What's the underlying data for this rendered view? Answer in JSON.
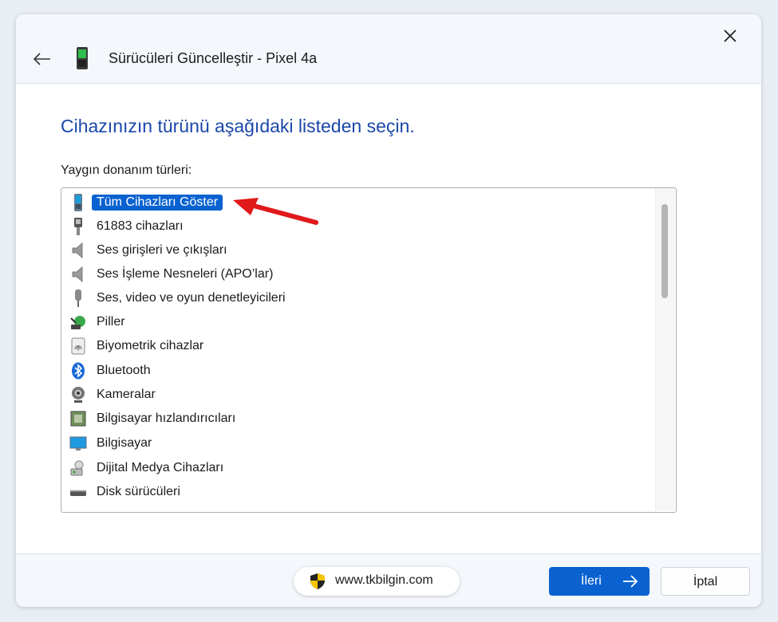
{
  "window": {
    "title": "Sürücüleri Güncelleştir - Pixel 4a"
  },
  "main": {
    "heading": "Cihazınızın türünü aşağıdaki listeden seçin.",
    "list_label": "Yaygın donanım türleri:",
    "items": [
      {
        "label": "Tüm Cihazları Göster",
        "icon": "phone-device-icon",
        "selected": true
      },
      {
        "label": "61883 cihazları",
        "icon": "firewire-connector-icon"
      },
      {
        "label": "Ses girişleri ve çıkışları",
        "icon": "speaker-icon"
      },
      {
        "label": "Ses İşleme Nesneleri (APO’lar)",
        "icon": "speaker-icon"
      },
      {
        "label": "Ses, video ve oyun denetleyicileri",
        "icon": "plug-icon"
      },
      {
        "label": "Piller",
        "icon": "battery-icon"
      },
      {
        "label": "Biyometrik cihazlar",
        "icon": "fingerprint-icon"
      },
      {
        "label": "Bluetooth",
        "icon": "bluetooth-icon"
      },
      {
        "label": "Kameralar",
        "icon": "camera-icon"
      },
      {
        "label": "Bilgisayar hızlandırıcıları",
        "icon": "chip-icon"
      },
      {
        "label": "Bilgisayar",
        "icon": "monitor-icon"
      },
      {
        "label": "Dijital Medya Cihazları",
        "icon": "media-device-icon"
      },
      {
        "label": "Disk sürücüleri",
        "icon": "disk-drive-icon"
      }
    ]
  },
  "footer": {
    "watermark": "www.tkbilgin.com",
    "next_label": "İleri",
    "cancel_label": "İptal"
  },
  "colors": {
    "accent": "#0a62d0",
    "heading": "#1a47a8",
    "annotation_arrow": "#e0191b"
  }
}
